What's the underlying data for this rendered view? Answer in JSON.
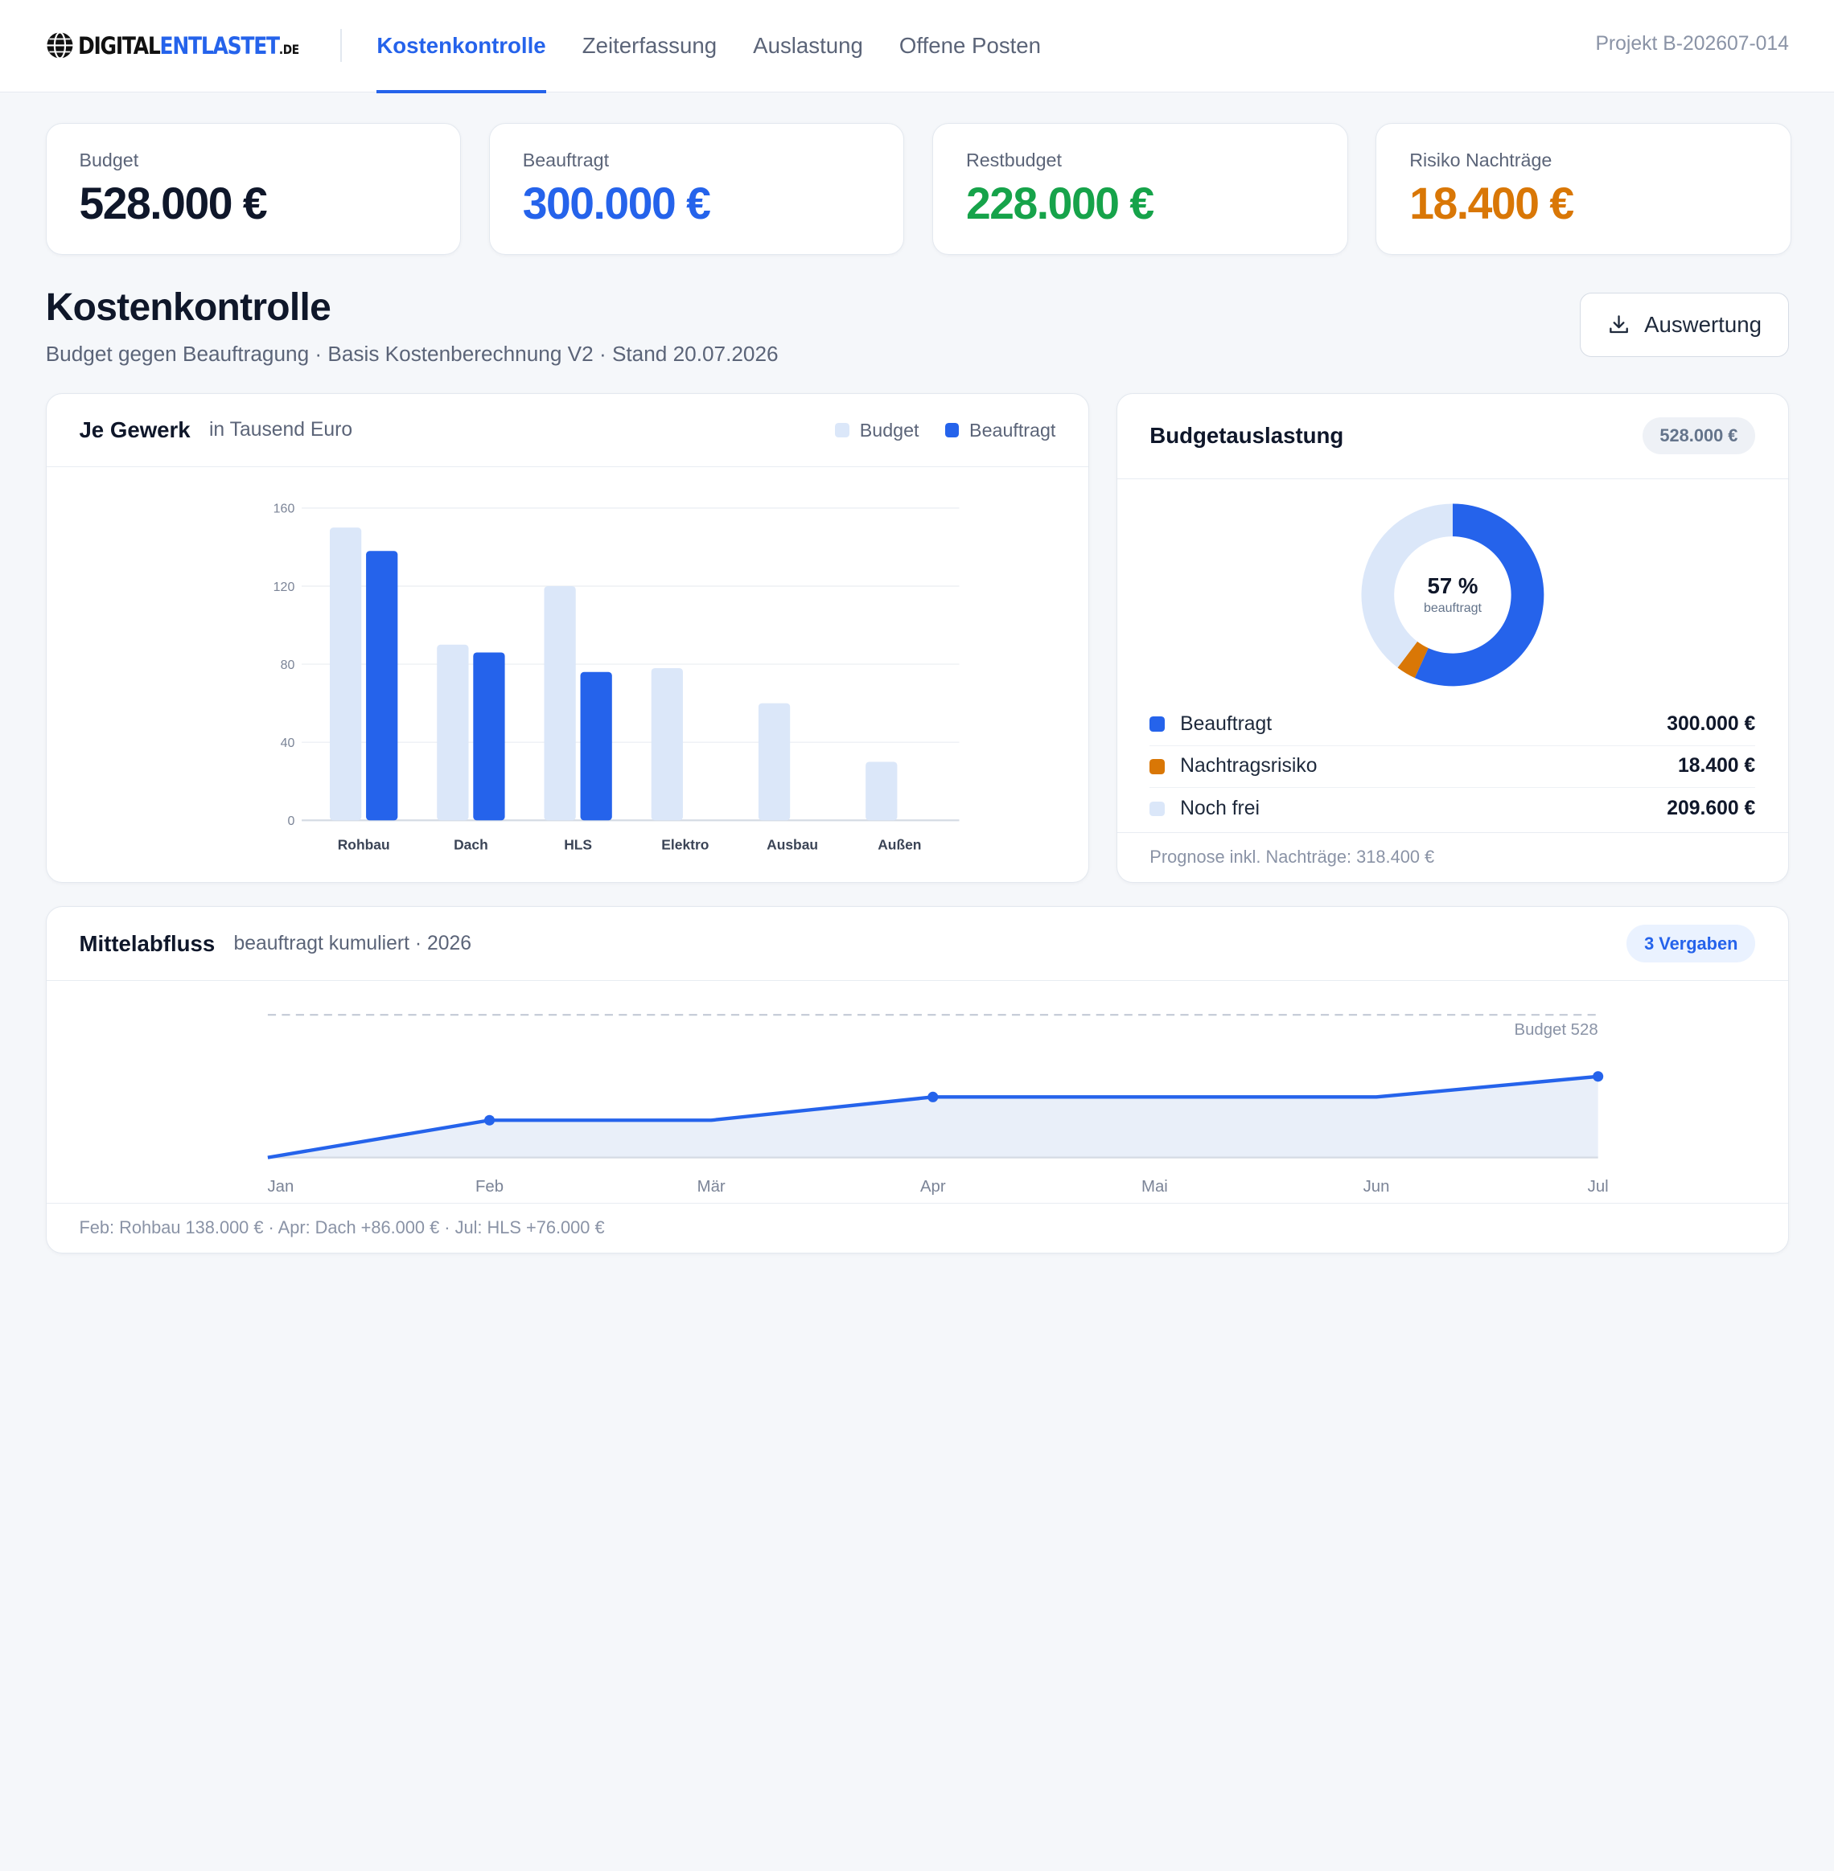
{
  "header": {
    "logo": {
      "part1": "DIGITAL",
      "part2": "ENTLASTET",
      "tld": ".DE"
    },
    "tabs": [
      {
        "label": "Kostenkontrolle",
        "active": true
      },
      {
        "label": "Zeiterfassung",
        "active": false
      },
      {
        "label": "Auslastung",
        "active": false
      },
      {
        "label": "Offene Posten",
        "active": false
      }
    ],
    "project": "Projekt B-202607-014"
  },
  "kpis": [
    {
      "label": "Budget",
      "value": "528.000 €",
      "color": "#0f172a"
    },
    {
      "label": "Beauftragt",
      "value": "300.000 €",
      "color": "#2563eb"
    },
    {
      "label": "Restbudget",
      "value": "228.000 €",
      "color": "#16a34a"
    },
    {
      "label": "Risiko Nachträge",
      "value": "18.400 €",
      "color": "#d97706"
    }
  ],
  "section": {
    "title": "Kostenkontrolle",
    "subtitle": "Budget gegen Beauftragung · Basis Kostenberechnung V2 · Stand 20.07.2026",
    "export_label": "Auswertung",
    "export_icon": "download-icon"
  },
  "colors": {
    "accent": "#2563eb",
    "budget_bar": "#dbe7f9",
    "risk": "#d97706",
    "free": "#dbe7f9",
    "green": "#16a34a"
  },
  "bar_card": {
    "title": "Je Gewerk",
    "hint": "in Tausend Euro",
    "legend": [
      "Budget",
      "Beauftragt"
    ]
  },
  "donut_card": {
    "title": "Budgetauslastung",
    "pill": "528.000 €",
    "center_value": "57 %",
    "center_caption": "beauftragt",
    "items": [
      {
        "label": "Beauftragt",
        "amount": "300.000 €",
        "color": "#2563eb"
      },
      {
        "label": "Nachtragsrisiko",
        "amount": "18.400 €",
        "color": "#d97706"
      },
      {
        "label": "Noch frei",
        "amount": "209.600 €",
        "color": "#dbe7f9"
      }
    ],
    "footer": "Prognose inkl. Nachträge: 318.400 €"
  },
  "flow_card": {
    "title": "Mittelabfluss",
    "hint": "beauftragt kumuliert · 2026",
    "badge": "3 Vergaben",
    "budget_line_label": "Budget 528",
    "footer": "Feb: Rohbau 138.000 € · Apr: Dach +86.000 € · Jul: HLS +76.000 €"
  },
  "chart_data": [
    {
      "type": "bar",
      "categories": [
        "Rohbau",
        "Dach",
        "HLS",
        "Elektro",
        "Ausbau",
        "Außen"
      ],
      "series": [
        {
          "name": "Budget",
          "values": [
            150,
            90,
            120,
            78,
            60,
            30
          ]
        },
        {
          "name": "Beauftragt",
          "values": [
            138,
            86,
            76,
            0,
            0,
            0
          ]
        }
      ],
      "yticks": [
        0,
        40,
        80,
        120,
        160
      ],
      "ylim": [
        0,
        160
      ],
      "grid": true,
      "legend": "top-right"
    },
    {
      "type": "pie",
      "labels": [
        "Beauftragt",
        "Nachtragsrisiko",
        "Noch frei"
      ],
      "values": [
        300000,
        18400,
        209600
      ],
      "donut": true
    },
    {
      "type": "area",
      "x": [
        "Jan",
        "Feb",
        "Mär",
        "Apr",
        "Mai",
        "Jun",
        "Jul"
      ],
      "values": [
        0,
        138,
        138,
        224,
        224,
        224,
        300
      ],
      "markers": [
        "Feb",
        "Apr",
        "Jul"
      ],
      "reference": 528,
      "ylim": [
        0,
        528
      ]
    }
  ]
}
